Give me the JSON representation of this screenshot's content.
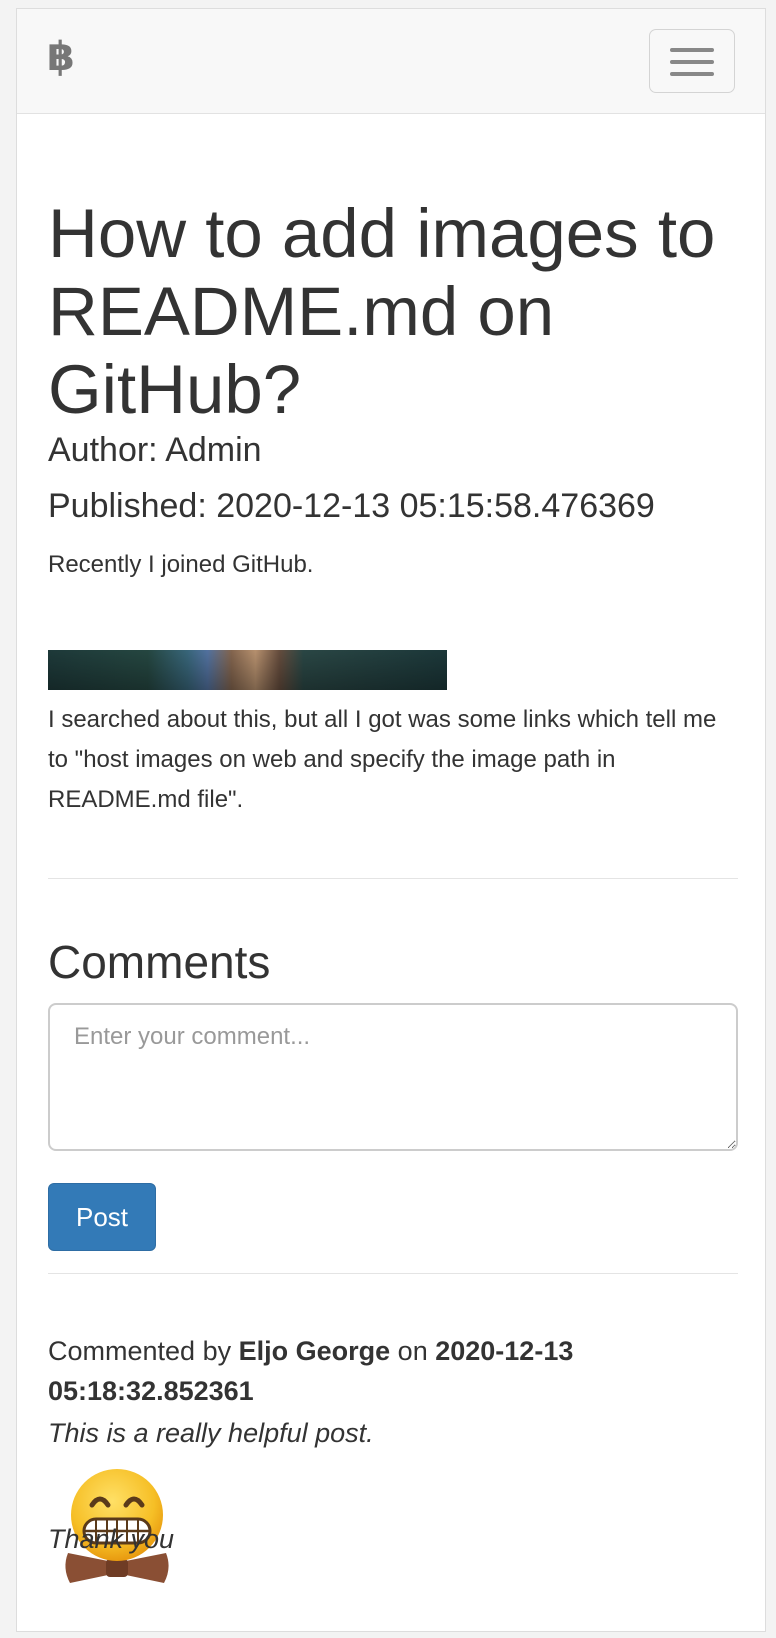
{
  "navbar": {
    "brand_glyph": "฿",
    "brand_icon": "bitcoin-icon",
    "toggle_icon": "hamburger-menu-icon"
  },
  "post": {
    "title": "How to add images to README.md on GitHub?",
    "author": "Author: Admin",
    "published": "Published: 2020-12-13 05:15:58.476369",
    "intro": "Recently I joined GitHub.",
    "body": "I searched about this, but all I got was some links which tell me to \"host images on web and specify the image path in README.md file\"."
  },
  "comments": {
    "heading": "Comments",
    "input_placeholder": "Enter your comment...",
    "post_label": "Post",
    "list": [
      {
        "prefix": "Commented by",
        "author": "Eljo George",
        "on": "on",
        "date": "2020-12-13 05:18:32.852361",
        "text": "This is a really helpful post.",
        "emoji": "grimacing-face-bowtie-emoji",
        "footer": "Thank you"
      }
    ]
  },
  "colors": {
    "accent": "#337ab7",
    "text": "#333333",
    "navbar_bg": "#f8f8f8"
  }
}
